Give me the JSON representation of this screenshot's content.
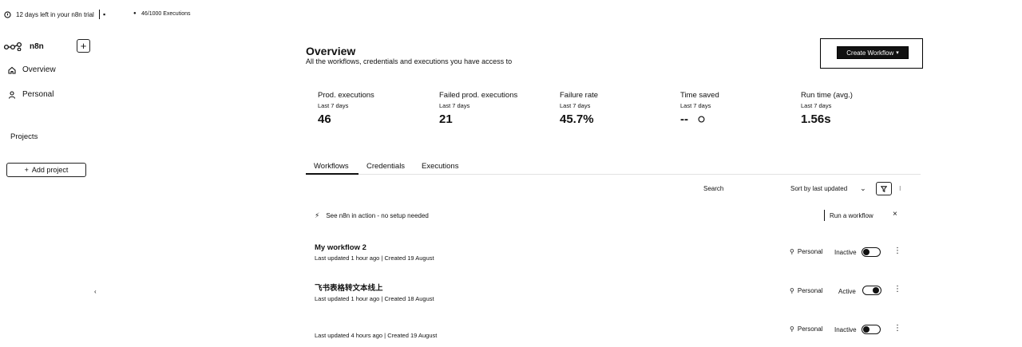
{
  "banner": {
    "trial_text": "12 days left in your n8n trial",
    "executions_text": "46/1000 Executions"
  },
  "sidebar": {
    "logo_text": "n8n",
    "new_button": "+",
    "items": [
      {
        "label": "Overview",
        "icon": "home-icon"
      },
      {
        "label": "Personal",
        "icon": "user-icon"
      }
    ],
    "section_title": "Projects",
    "add_project_label": "Add project",
    "collapse_glyph": "‹"
  },
  "header": {
    "title": "Overview",
    "subtitle": "All the workflows, credentials and executions you have access to",
    "create_button_label": "Create Workflow"
  },
  "stats": [
    {
      "label": "Prod. executions",
      "period": "Last 7 days",
      "value": "46"
    },
    {
      "label": "Failed prod. executions",
      "period": "Last 7 days",
      "value": "21"
    },
    {
      "label": "Failure rate",
      "period": "Last 7 days",
      "value": "45.7%"
    },
    {
      "label": "Time saved",
      "period": "Last 7 days",
      "value": "--"
    },
    {
      "label": "Run time (avg.)",
      "period": "Last 7 days",
      "value": "1.56s"
    }
  ],
  "tabs": [
    {
      "label": "Workflows",
      "active": true
    },
    {
      "label": "Credentials",
      "active": false
    },
    {
      "label": "Executions",
      "active": false
    }
  ],
  "toolbar": {
    "search_placeholder": "Search",
    "sort_label": "Sort by last updated"
  },
  "callout": {
    "text": "See n8n in action - no setup needed",
    "button_label": "Run a workflow",
    "close_glyph": "×"
  },
  "workflows": [
    {
      "name": "My workflow 2",
      "updated": "Last updated 1 hour ago",
      "created": "Created 19 August",
      "owner": "Personal",
      "status": "Inactive",
      "active": false
    },
    {
      "name": "飞书表格转文本线上",
      "updated": "Last updated 1 hour ago",
      "created": "Created 18 August",
      "owner": "Personal",
      "status": "Active",
      "active": true
    },
    {
      "name": "",
      "updated": "Last updated 4 hours ago",
      "created": "Created 19 August",
      "owner": "Personal",
      "status": "Inactive",
      "active": false
    }
  ],
  "colors": {
    "text": "#111111",
    "background": "#ffffff",
    "button_dark": "#111111"
  }
}
